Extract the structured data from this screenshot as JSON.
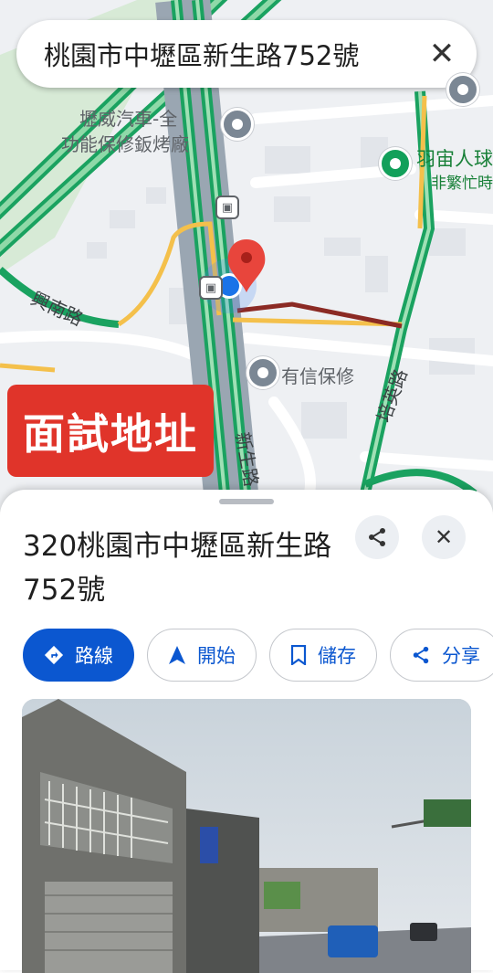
{
  "search": {
    "text": "桃園市中壢區新生路752號",
    "close_icon": "close-icon"
  },
  "map": {
    "labels": {
      "poi1": "壢威汽車-全",
      "poi1b": "功能保修鈑烤廠",
      "poi2": "羽宙人球",
      "poi2_status": "非繁忙時",
      "poi3": "有信保修",
      "road1": "興南路",
      "road2": "培英路",
      "road3": "新生路"
    },
    "colors": {
      "highway": "#1aa260",
      "arterial": "#f4c04b",
      "traffic_red": "#8b2a24",
      "pin": "#e8453c",
      "location": "#1a73e8"
    }
  },
  "overlay": {
    "text": "面試地址",
    "color": "#e0342a"
  },
  "sheet": {
    "title": "320桃園市中壢區新生路752號",
    "share_icon": "share-icon",
    "close_icon": "close-icon",
    "actions": {
      "directions": "路線",
      "start": "開始",
      "save": "儲存",
      "share": "分享"
    }
  }
}
